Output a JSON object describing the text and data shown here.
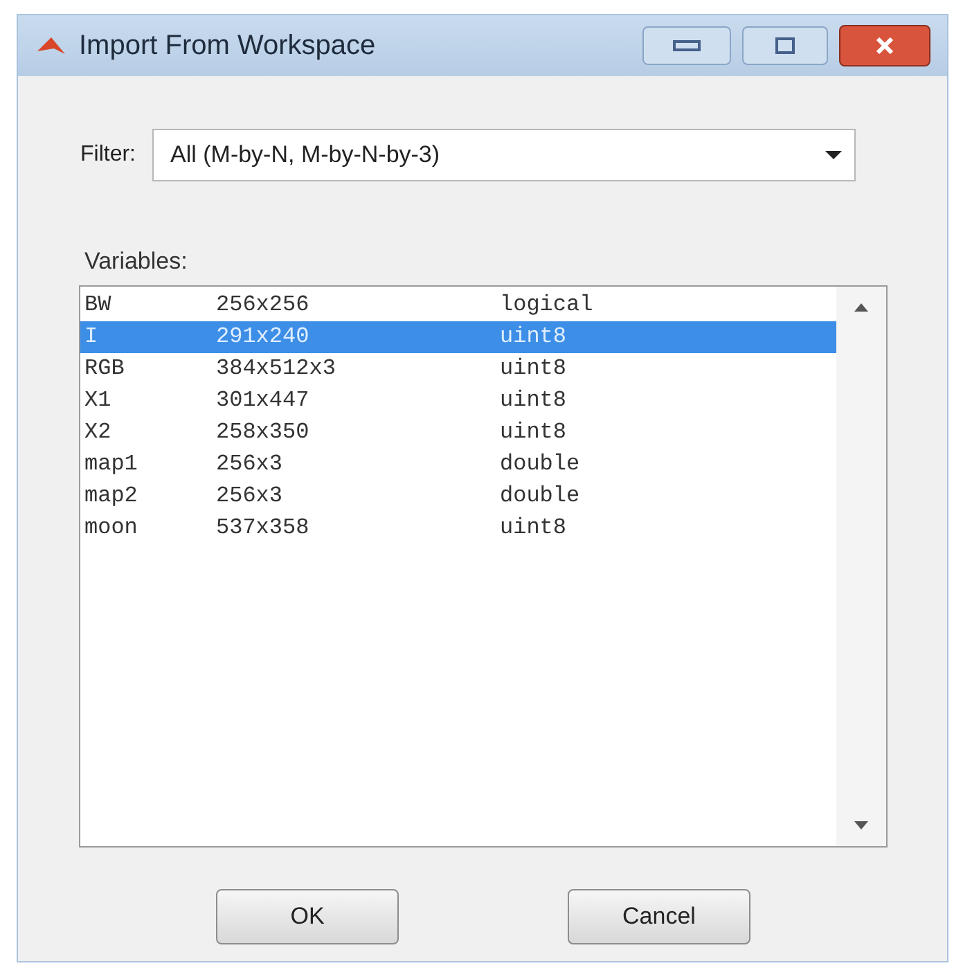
{
  "window": {
    "title": "Import From Workspace"
  },
  "filter": {
    "label": "Filter:",
    "value": "All (M-by-N, M-by-N-by-3)"
  },
  "variables": {
    "label": "Variables:",
    "rows": [
      {
        "name": "BW",
        "size": "256x256",
        "class": "logical",
        "selected": false
      },
      {
        "name": "I",
        "size": "291x240",
        "class": "uint8",
        "selected": true
      },
      {
        "name": "RGB",
        "size": "384x512x3",
        "class": "uint8",
        "selected": false
      },
      {
        "name": "X1",
        "size": "301x447",
        "class": "uint8",
        "selected": false
      },
      {
        "name": "X2",
        "size": "258x350",
        "class": "uint8",
        "selected": false
      },
      {
        "name": "map1",
        "size": "256x3",
        "class": "double",
        "selected": false
      },
      {
        "name": "map2",
        "size": "256x3",
        "class": "double",
        "selected": false
      },
      {
        "name": "moon",
        "size": "537x358",
        "class": "uint8",
        "selected": false
      }
    ]
  },
  "buttons": [
    "OK",
    "Cancel"
  ]
}
